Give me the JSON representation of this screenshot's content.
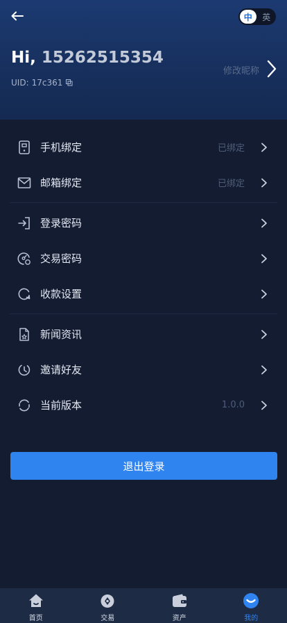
{
  "header": {
    "greeting_prefix": "Hi,",
    "phone": "15262515354",
    "uid_label": "UID:",
    "uid_value": "17c361",
    "edit_nickname": "修改昵称",
    "lang_active": "中",
    "lang_inactive": "英"
  },
  "menu": {
    "bind_phone": {
      "label": "手机绑定",
      "value": "已绑定"
    },
    "bind_email": {
      "label": "邮箱绑定",
      "value": "已绑定"
    },
    "login_password": {
      "label": "登录密码"
    },
    "trade_password": {
      "label": "交易密码"
    },
    "payment_settings": {
      "label": "收款设置"
    },
    "news": {
      "label": "新闻资讯"
    },
    "invite_friends": {
      "label": "邀请好友"
    },
    "current_version": {
      "label": "当前版本",
      "value": "1.0.0"
    }
  },
  "logout_label": "退出登录",
  "tabbar": {
    "home": "首页",
    "trade": "交易",
    "assets": "资产",
    "mine": "我的"
  },
  "colors": {
    "accent": "#2f84f0",
    "background": "#131c30",
    "header": "#1c3a72"
  }
}
